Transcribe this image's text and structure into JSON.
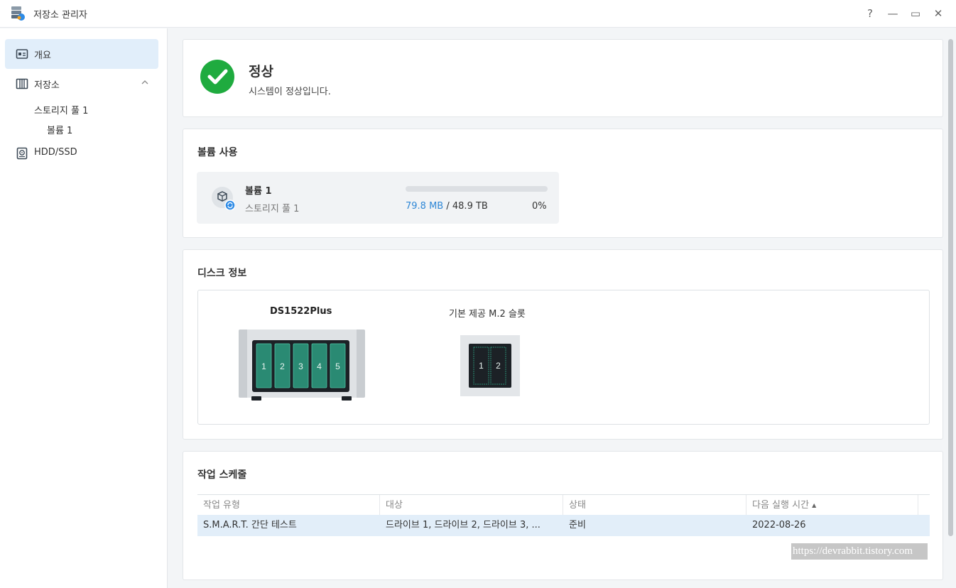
{
  "window": {
    "title": "저장소 관리자",
    "buttons": {
      "help": "?",
      "minimize": "—",
      "maximize": "▭",
      "close": "✕"
    }
  },
  "sidebar": {
    "items": [
      {
        "label": "개요",
        "icon": "overview-icon",
        "active": true
      },
      {
        "label": "저장소",
        "icon": "storage-icon",
        "expanded": true
      },
      {
        "label": "HDD/SSD",
        "icon": "hdd-icon"
      }
    ],
    "storage_children": {
      "pool": "스토리지 풀 1",
      "volume": "볼륨 1"
    }
  },
  "status": {
    "title": "정상",
    "description": "시스템이 정상입니다.",
    "color": "#1fab3f"
  },
  "volume_usage": {
    "title": "볼륨 사용",
    "volume": {
      "name": "볼륨 1",
      "pool": "스토리지 풀 1",
      "used": "79.8 MB",
      "separator": "/",
      "total": "48.9 TB",
      "percent_label": "0%",
      "percent": 0
    }
  },
  "disk_info": {
    "title": "디스크 정보",
    "device": {
      "name": "DS1522Plus",
      "bays": [
        "1",
        "2",
        "3",
        "4",
        "5"
      ]
    },
    "m2": {
      "name": "기본 제공 M.2 슬롯",
      "slots": [
        "1",
        "2"
      ]
    }
  },
  "schedule": {
    "title": "작업 스케줄",
    "columns": [
      "작업 유형",
      "대상",
      "상태",
      "다음 실행 시간"
    ],
    "sort_indicator": "▲",
    "rows": [
      {
        "type": "S.M.A.R.T. 간단 테스트",
        "target": "드라이브 1, 드라이브 2, 드라이브 3, ...",
        "status": "준비",
        "next": "2022-08-26"
      }
    ]
  },
  "watermark": "https://devrabbit.tistory.com",
  "colors": {
    "accent": "#2e8be6",
    "success": "#1fab3f",
    "bay": "#2a8a73"
  }
}
